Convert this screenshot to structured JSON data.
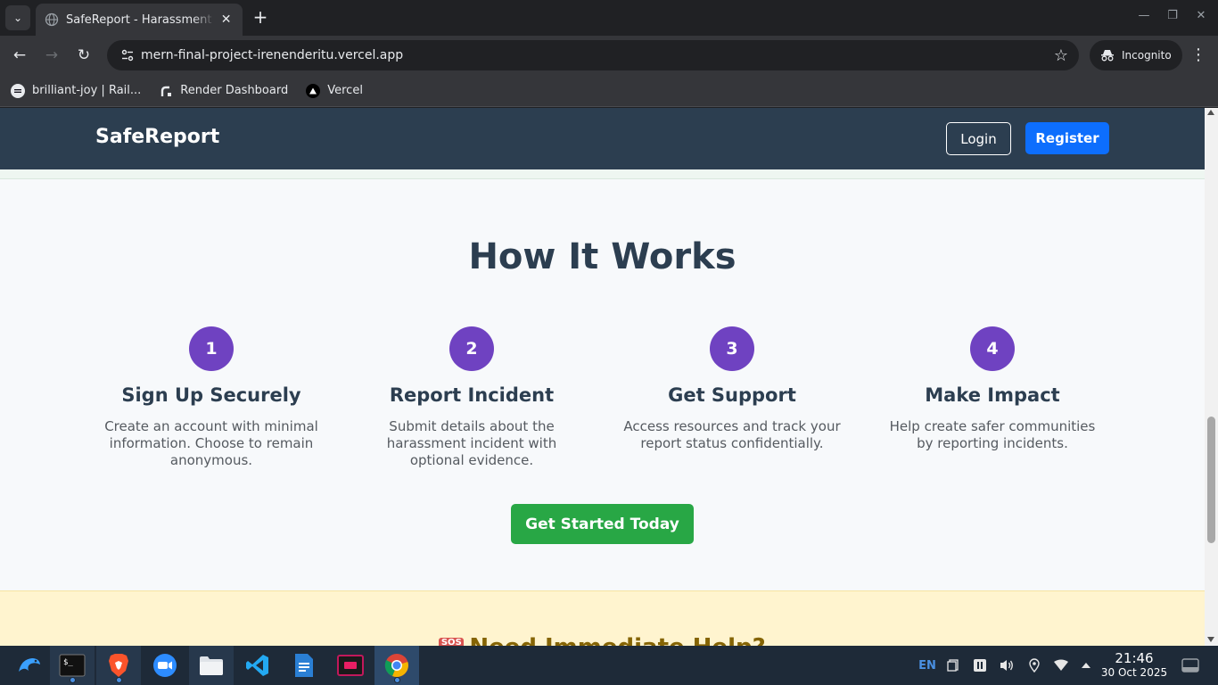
{
  "browser": {
    "tab": {
      "title": "SafeReport - Harassment Reporting",
      "close": "✕"
    },
    "new_tab": "+",
    "window_controls": {
      "minimize": "—",
      "restore": "❐",
      "close": "✕"
    },
    "url": "mern-final-project-irenenderitu.vercel.app",
    "incognito_label": "Incognito",
    "bookmarks": [
      {
        "label": "brilliant-joy | Rail...",
        "icon": "railway-icon"
      },
      {
        "label": "Render Dashboard",
        "icon": "render-icon"
      },
      {
        "label": "Vercel",
        "icon": "vercel-icon"
      }
    ]
  },
  "site": {
    "brand": "SafeReport",
    "login_label": "Login",
    "register_label": "Register",
    "how_it_works": {
      "title": "How It Works",
      "steps": [
        {
          "number": "1",
          "title": "Sign Up Securely",
          "description": "Create an account with minimal information. Choose to remain anonymous."
        },
        {
          "number": "2",
          "title": "Report Incident",
          "description": "Submit details about the harassment incident with optional evidence."
        },
        {
          "number": "3",
          "title": "Get Support",
          "description": "Access resources and track your report status confidentially."
        },
        {
          "number": "4",
          "title": "Make Impact",
          "description": "Help create safer communities by reporting incidents."
        }
      ],
      "cta_label": "Get Started Today"
    },
    "help": {
      "sos_label": "SOS",
      "title": "Need Immediate Help?"
    }
  },
  "taskbar": {
    "language": "EN",
    "time": "21:46",
    "date": "30 Oct 2025"
  },
  "colors": {
    "nav_bg": "#2c3e50",
    "step_circle": "#6f42c1",
    "register": "#0d6efd",
    "cta": "#28a745",
    "help_bg": "#fff4cf"
  }
}
